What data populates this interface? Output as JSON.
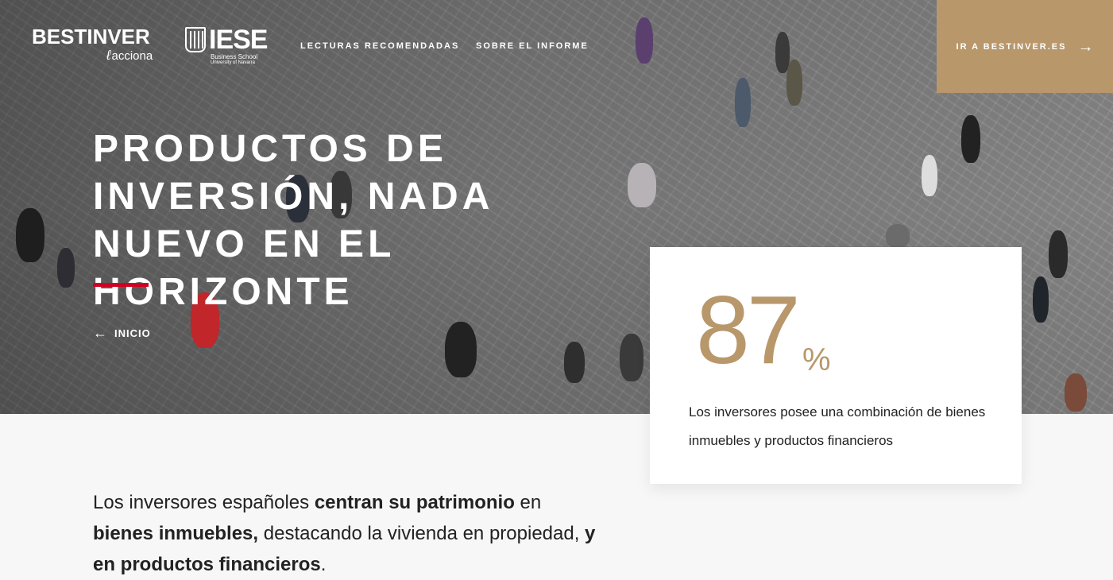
{
  "header": {
    "logo_bestinver": "BESTINVER",
    "logo_bestinver_sub": "acciona",
    "logo_iese": "IESE",
    "logo_iese_sub1": "Business School",
    "logo_iese_sub2": "University of Navarra",
    "nav": [
      {
        "label": "LECTURAS RECOMENDADAS"
      },
      {
        "label": "SOBRE EL INFORME"
      }
    ],
    "cta_label": "IR A BESTINVER.ES"
  },
  "hero": {
    "title": "PRODUCTOS DE INVERSIÓN, NADA NUEVO EN EL HORIZONTE",
    "back_label": "INICIO"
  },
  "stat": {
    "value": "87",
    "unit": "%",
    "description": "Los inversores posee una combinación de bienes inmuebles y productos financieros"
  },
  "intro": {
    "parts": [
      {
        "text": "Los inversores españoles ",
        "bold": false
      },
      {
        "text": "centran su patrimonio",
        "bold": true
      },
      {
        "text": " en ",
        "bold": false
      },
      {
        "text": "bienes inmuebles,",
        "bold": true
      },
      {
        "text": " destacando la vivienda en propiedad, ",
        "bold": false
      },
      {
        "text": "y en productos financieros",
        "bold": true
      },
      {
        "text": ".",
        "bold": false
      }
    ]
  },
  "colors": {
    "accent_gold": "#b8976b",
    "accent_red": "#d1001f",
    "text_dark": "#222222"
  },
  "icons": {
    "cta_arrow": "arrow-right-icon",
    "back_arrow": "arrow-left-icon"
  }
}
